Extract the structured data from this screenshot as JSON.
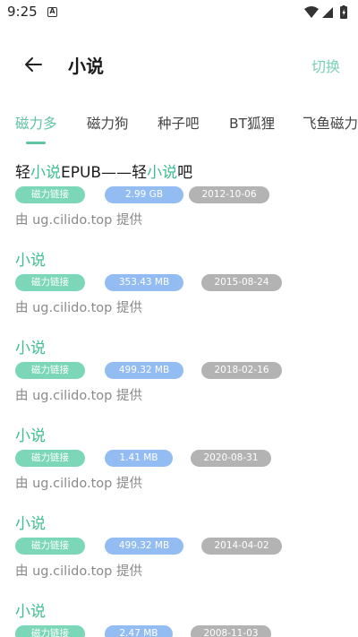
{
  "status_bar": {
    "time": "9:25",
    "notification_icon": "A"
  },
  "app_bar": {
    "title": "小说",
    "switch_label": "切换"
  },
  "tabs": [
    {
      "label": "磁力多",
      "active": true
    },
    {
      "label": "磁力狗",
      "active": false
    },
    {
      "label": "种子吧",
      "active": false
    },
    {
      "label": "BT狐狸",
      "active": false
    },
    {
      "label": "飞鱼磁力",
      "active": false
    }
  ],
  "results": [
    {
      "title_pre": "轻",
      "title_hl": "小说",
      "title_mid": "EPUB——轻",
      "title_hl2": "小说",
      "title_post": "吧",
      "type": "磁力链接",
      "size": "2.99 GB",
      "date": "2012-10-06",
      "source": "由 ug.cilido.top 提供"
    },
    {
      "title_pre": "",
      "title_hl": "小说",
      "title_mid": "",
      "title_hl2": "",
      "title_post": "",
      "type": "磁力链接",
      "size": "353.43 MB",
      "date": "2015-08-24",
      "source": "由 ug.cilido.top 提供"
    },
    {
      "title_pre": "",
      "title_hl": "小说",
      "title_mid": "",
      "title_hl2": "",
      "title_post": "",
      "type": "磁力链接",
      "size": "499.32 MB",
      "date": "2018-02-16",
      "source": "由 ug.cilido.top 提供"
    },
    {
      "title_pre": "",
      "title_hl": "小说",
      "title_mid": "",
      "title_hl2": "",
      "title_post": "",
      "type": "磁力链接",
      "size": "1.41 MB",
      "date": "2020-08-31",
      "source": "由 ug.cilido.top 提供"
    },
    {
      "title_pre": "",
      "title_hl": "小说",
      "title_mid": "",
      "title_hl2": "",
      "title_post": "",
      "type": "磁力链接",
      "size": "499.32 MB",
      "date": "2014-04-02",
      "source": "由 ug.cilido.top 提供"
    },
    {
      "title_pre": "",
      "title_hl": "小说",
      "title_mid": "",
      "title_hl2": "",
      "title_post": "",
      "type": "磁力链接",
      "size": "2.47 MB",
      "date": "2008-11-03",
      "source": ""
    }
  ],
  "colors": {
    "accent": "#62c3a0",
    "link_badge": "#7cd7b8",
    "size_badge": "#93bdf2",
    "date_badge": "#b3b3b3"
  }
}
